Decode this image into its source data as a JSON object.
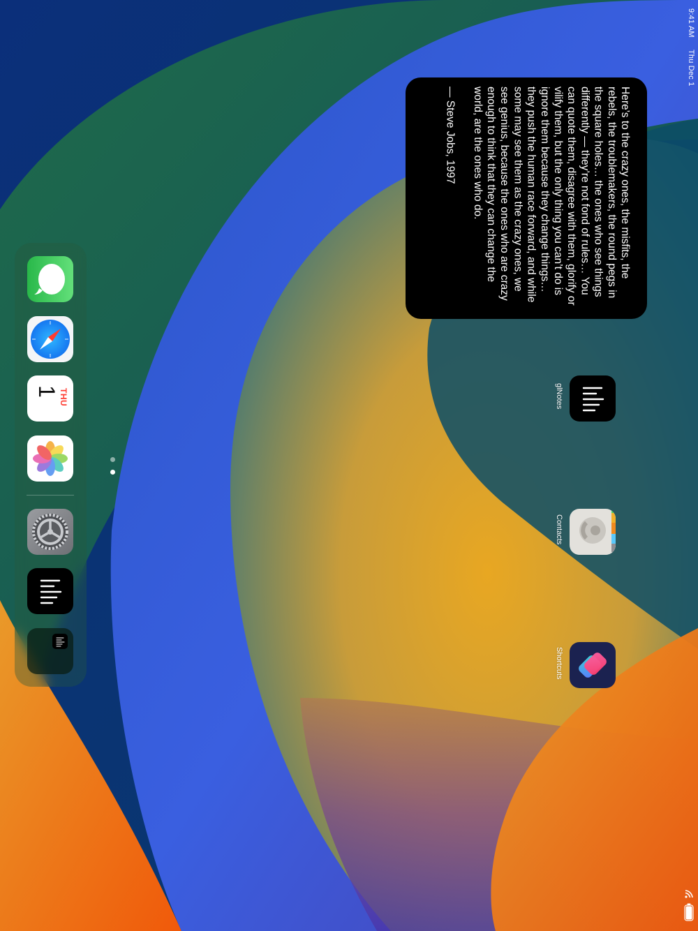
{
  "status_bar": {
    "time": "9:41 AM",
    "date": "Thu Dec 1"
  },
  "quote_widget": {
    "text": "Here’s to the crazy ones, the misfits, the rebels, the troublemakers, the round pegs in the square holes… the ones who see things differently — they’re not fond of rules… You can quote them, disagree with them, glorify or vilify them, but the only thing you can’t do is ignore them because they change things… they push the human race forward, and while some may see them as the crazy ones, we see genius, because the ones who are crazy enough to think that they can change the world, are the ones who do.",
    "author": "— Steve Jobs, 1997"
  },
  "home_apps": [
    {
      "label": "glNotes",
      "icon": "glnotes-icon"
    },
    {
      "label": "Contacts",
      "icon": "contacts-icon"
    },
    {
      "label": "Shortcuts",
      "icon": "shortcuts-icon"
    }
  ],
  "dock": {
    "apps": [
      {
        "name": "Messages",
        "icon": "messages-icon"
      },
      {
        "name": "Safari",
        "icon": "safari-icon"
      },
      {
        "name": "Calendar",
        "icon": "calendar-icon",
        "day_label": "THU",
        "date_number": "1"
      },
      {
        "name": "Photos",
        "icon": "photos-icon"
      },
      {
        "name": "Settings",
        "icon": "settings-icon"
      },
      {
        "name": "glNotes",
        "icon": "glnotes-icon"
      },
      {
        "name": "App Library",
        "icon": "app-library-icon"
      }
    ]
  },
  "page_indicator": {
    "pages": 2,
    "current_page": 2
  },
  "colors": {
    "messages_green": "#34c759",
    "calendar_red": "#ff3b30",
    "widget_bg": "#000000",
    "shortcuts_bg": "#1b2250"
  }
}
